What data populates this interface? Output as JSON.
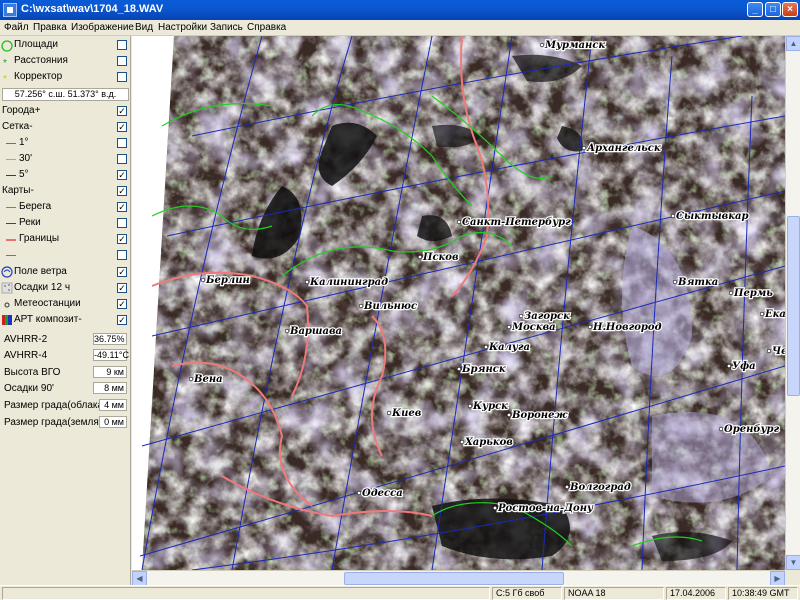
{
  "window": {
    "title": "C:\\wxsat\\wav\\1704_18.WAV",
    "min_label": "_",
    "max_label": "□",
    "close_label": "×"
  },
  "menu": [
    {
      "label": "Файл"
    },
    {
      "label": "Правка"
    },
    {
      "label": "Изображение"
    },
    {
      "label": "Вид"
    },
    {
      "label": "Настройки"
    },
    {
      "label": "Запись"
    },
    {
      "label": "Справка"
    }
  ],
  "panel": {
    "tools": [
      {
        "label": "Площади",
        "checked": false
      },
      {
        "label": "Расстояния",
        "checked": false
      },
      {
        "label": "Корректор",
        "checked": false
      }
    ],
    "coords": "57.256° с.ш. 51.373° в.д.",
    "cities": {
      "label": "Города+",
      "checked": true
    },
    "grid": {
      "label": "Сетка-",
      "checked": true
    },
    "grid_items": [
      {
        "label": "1°",
        "color": "#e04040",
        "checked": false
      },
      {
        "label": "30'",
        "color": "#60d080",
        "checked": false
      },
      {
        "label": "5°",
        "color": "#2030c0",
        "checked": true
      }
    ],
    "maps": {
      "label": "Карты-",
      "checked": true
    },
    "map_items": [
      {
        "label": "Берега",
        "color": "#20c020",
        "checked": true
      },
      {
        "label": "Реки",
        "color": "#2040c0",
        "checked": false
      },
      {
        "label": "Границы",
        "color": "#e87070",
        "checked": true
      },
      {
        "label": "",
        "color": "#c040c0",
        "checked": false
      }
    ],
    "overlays": [
      {
        "label": "Поле ветра",
        "icon": "wind-icon",
        "checked": true
      },
      {
        "label": "Осадки 12 ч",
        "icon": "precip-icon",
        "checked": true
      },
      {
        "label": "Метеостанции",
        "icon": "station-icon",
        "checked": true
      },
      {
        "label": "АРТ композит-",
        "icon": "apt-icon",
        "checked": true
      }
    ],
    "values": [
      {
        "label": "AVHRR-2",
        "value": "36.75%"
      },
      {
        "label": "AVHRR-4",
        "value": "-49.11°C"
      },
      {
        "label": "Высота ВГО",
        "value": "9 км"
      },
      {
        "label": "Осадки 90'",
        "value": "8 мм"
      },
      {
        "label": "Размер града(облака)",
        "value": "4 мм"
      },
      {
        "label": "Размер града(земля)",
        "value": "0 мм"
      }
    ],
    "check_mark": "✓"
  },
  "map": {
    "cities": [
      {
        "name": "Мурманск"
      },
      {
        "name": "Архангельск"
      },
      {
        "name": "Санкт-Петербург"
      },
      {
        "name": "Сыктывкар"
      },
      {
        "name": "Псков"
      },
      {
        "name": "Берлин"
      },
      {
        "name": "Калининград"
      },
      {
        "name": "Вильнюс"
      },
      {
        "name": "Вятка"
      },
      {
        "name": "Пермь"
      },
      {
        "name": "Ека"
      },
      {
        "name": "Загорск"
      },
      {
        "name": "Москва"
      },
      {
        "name": "Н.Новгород"
      },
      {
        "name": "Варшава"
      },
      {
        "name": "Че"
      },
      {
        "name": "Калуга"
      },
      {
        "name": "Уфа"
      },
      {
        "name": "Брянск"
      },
      {
        "name": "Вена"
      },
      {
        "name": "Курск"
      },
      {
        "name": "Киев"
      },
      {
        "name": "Воронеж"
      },
      {
        "name": "Оренбург"
      },
      {
        "name": "Харьков"
      },
      {
        "name": "Волгоград"
      },
      {
        "name": "Одесса"
      },
      {
        "name": "Ростов-на-Дону"
      }
    ]
  },
  "status": {
    "disk": "C:5 Гб своб",
    "satellite": "NOAA 18",
    "date": "17.04.2006",
    "time": "10:38:49 GMT"
  }
}
